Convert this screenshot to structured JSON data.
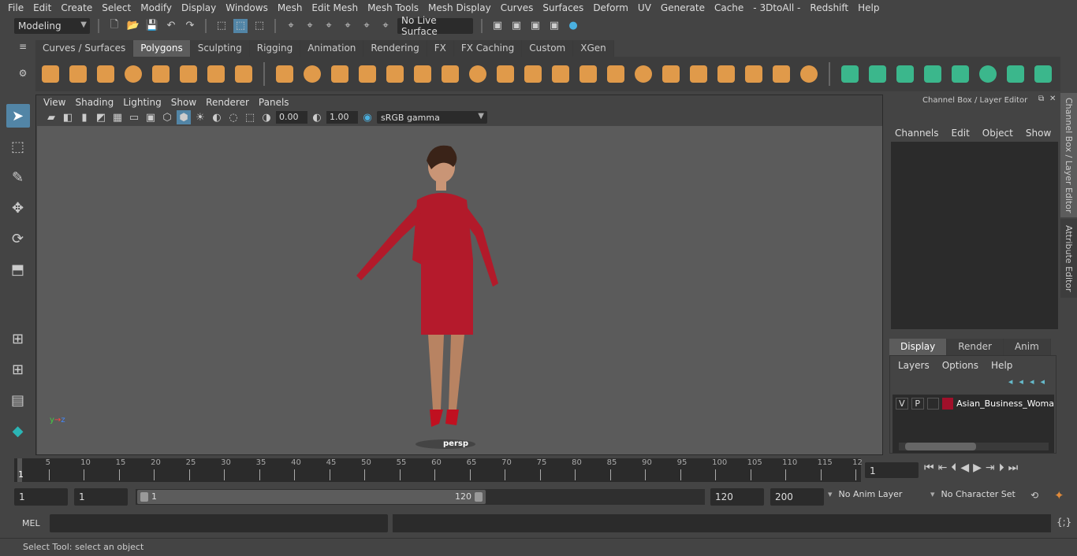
{
  "menu": [
    "File",
    "Edit",
    "Create",
    "Select",
    "Modify",
    "Display",
    "Windows",
    "Mesh",
    "Edit Mesh",
    "Mesh Tools",
    "Mesh Display",
    "Curves",
    "Surfaces",
    "Deform",
    "UV",
    "Generate",
    "Cache",
    "- 3DtoAll -",
    "Redshift",
    "Help"
  ],
  "status": {
    "mode": "Modeling",
    "live_surface": "No Live Surface"
  },
  "shelf_tabs": [
    "Curves / Surfaces",
    "Polygons",
    "Sculpting",
    "Rigging",
    "Animation",
    "Rendering",
    "FX",
    "FX Caching",
    "Custom",
    "XGen"
  ],
  "shelf_active": "Polygons",
  "viewport": {
    "menu": [
      "View",
      "Shading",
      "Lighting",
      "Show",
      "Renderer",
      "Panels"
    ],
    "exposure": "0.00",
    "gamma": "1.00",
    "color_space": "sRGB gamma",
    "camera": "persp"
  },
  "channel_box": {
    "title": "Channel Box / Layer Editor",
    "menu": [
      "Channels",
      "Edit",
      "Object",
      "Show"
    ],
    "layer_tabs": [
      "Display",
      "Render",
      "Anim"
    ],
    "layer_menu": [
      "Layers",
      "Options",
      "Help"
    ],
    "layer": {
      "v": "V",
      "p": "P",
      "name": "Asian_Business_Woma",
      "color": "#a0102a"
    }
  },
  "side_tabs": [
    "Channel Box / Layer Editor",
    "Attribute Editor"
  ],
  "timeline": {
    "ticks": [
      "5",
      "10",
      "15",
      "20",
      "25",
      "30",
      "35",
      "40",
      "45",
      "50",
      "55",
      "60",
      "65",
      "70",
      "75",
      "80",
      "85",
      "90",
      "95",
      "100",
      "105",
      "110",
      "115",
      "12"
    ],
    "current": "1",
    "current_field": "1"
  },
  "range": {
    "start": "1",
    "playback_start": "1",
    "slider_start": "1",
    "slider_end": "120",
    "playback_end": "120",
    "end": "200",
    "anim_layer": "No Anim Layer",
    "character_set": "No Character Set"
  },
  "command": {
    "label": "MEL"
  },
  "help_line": "Select Tool: select an object"
}
